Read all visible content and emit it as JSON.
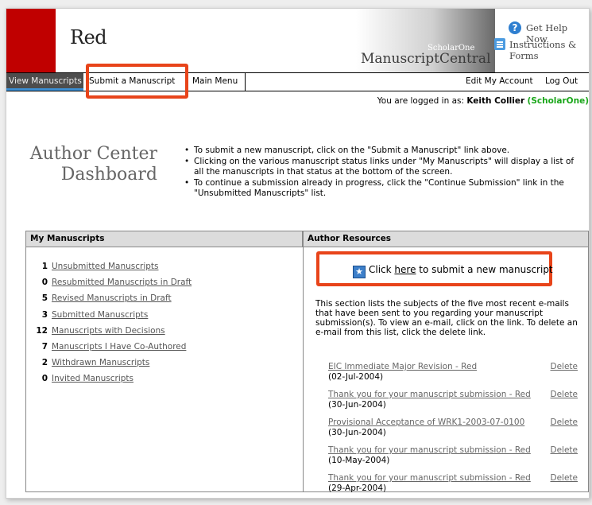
{
  "header": {
    "brand": "Red",
    "product_small": "ScholarOne",
    "product_big": "ManuscriptCentral",
    "help_label": "Get Help Now",
    "forms_label": "Instructions & Forms"
  },
  "nav": {
    "view": "View Manuscripts",
    "submit": "Submit a Manuscript",
    "main": "Main Menu",
    "edit": "Edit My Account",
    "logout": "Log Out"
  },
  "login": {
    "prefix": "You are logged in as: ",
    "user": "Keith Collier",
    "org": "(ScholarOne)"
  },
  "dashboard": {
    "title_line1": "Author Center",
    "title_line2": "Dashboard",
    "bullets": [
      "To submit a new manuscript, click on the \"Submit a Manuscript\" link above.",
      "Clicking on the various manuscript status links under \"My Manuscripts\" will display a list of all the manuscripts in that status at the bottom of the screen.",
      "To continue a submission already in progress, click the \"Continue Submission\" link in the \"Unsubmitted Manuscripts\" list."
    ]
  },
  "my_manuscripts": {
    "heading": "My Manuscripts",
    "items": [
      {
        "count": "1",
        "label": "Unsubmitted Manuscripts"
      },
      {
        "count": "0",
        "label": "Resubmitted Manuscripts in Draft"
      },
      {
        "count": "5",
        "label": "Revised Manuscripts in Draft"
      },
      {
        "count": "3",
        "label": "Submitted Manuscripts"
      },
      {
        "count": "12",
        "label": "Manuscripts with Decisions"
      },
      {
        "count": "7",
        "label": "Manuscripts I Have Co-Authored"
      },
      {
        "count": "2",
        "label": "Withdrawn Manuscripts"
      },
      {
        "count": "0",
        "label": "Invited Manuscripts"
      }
    ]
  },
  "author_resources": {
    "heading": "Author Resources",
    "click_prefix": "Click ",
    "here": "here",
    "click_suffix": " to submit a new manuscript",
    "description": "This section lists the subjects of the five most recent e-mails that have been sent to you regarding your manuscript submission(s). To view an e-mail, click on the link. To delete an e-mail from this list, click the delete link.",
    "delete_label": "Delete",
    "emails": [
      {
        "subject": "EIC Immediate Major Revision - Red",
        "date": "(02-Jul-2004)"
      },
      {
        "subject": "Thank you for your manuscript submission - Red",
        "date": "(30-Jun-2004)"
      },
      {
        "subject": "Provisional Acceptance of WRK1-2003-07-0100",
        "date": "(30-Jun-2004)"
      },
      {
        "subject": "Thank you for your manuscript submission - Red",
        "date": "(10-May-2004)"
      },
      {
        "subject": "Thank you for your manuscript submission - Red",
        "date": "(29-Apr-2004)"
      }
    ]
  },
  "colors": {
    "brand_red": "#c00000",
    "highlight": "#e8441a",
    "org_green": "#1aa61a",
    "nav_active": "#4d4d4d"
  }
}
